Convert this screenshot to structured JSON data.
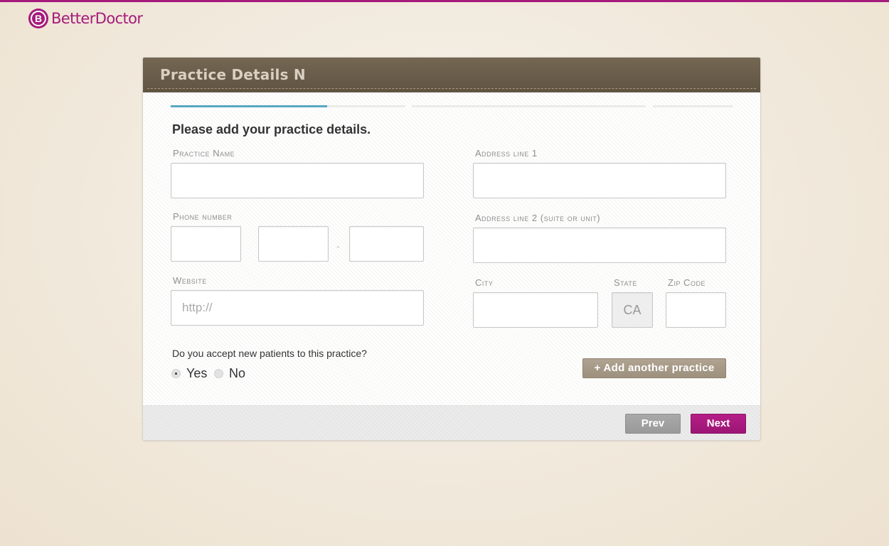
{
  "brand": {
    "name": "BetterDoctor",
    "mark": "B",
    "accent_color": "#a51a7b"
  },
  "card": {
    "title": "Practice Details N",
    "heading": "Please add your practice details.",
    "progress": {
      "active_step": 1,
      "total_steps": 4
    }
  },
  "form": {
    "practice_name": {
      "label": "Practice Name",
      "value": "",
      "placeholder": ""
    },
    "phone": {
      "label": "Phone number",
      "area": "",
      "prefix": "",
      "line": "",
      "separator": "-"
    },
    "website": {
      "label": "Website",
      "value": "",
      "placeholder": "http://"
    },
    "address1": {
      "label": "Address line 1",
      "value": ""
    },
    "address2": {
      "label": "Address line 2 (suite or unit)",
      "value": ""
    },
    "city": {
      "label": "City",
      "value": ""
    },
    "state": {
      "label": "State",
      "value": "CA"
    },
    "zip": {
      "label": "Zip Code",
      "value": ""
    },
    "new_patients": {
      "question": "Do you accept new patients to this practice?",
      "options": [
        {
          "label": "Yes",
          "checked": true
        },
        {
          "label": "No",
          "checked": false
        }
      ]
    },
    "add_practice_label": "+ Add another practice"
  },
  "footer": {
    "prev_label": "Prev",
    "next_label": "Next"
  }
}
